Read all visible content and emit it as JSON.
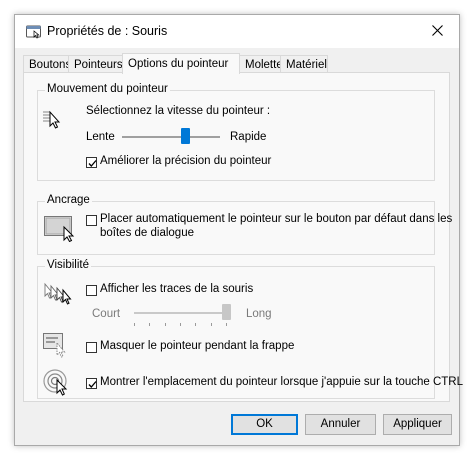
{
  "window": {
    "title": "Propriétés de : Souris"
  },
  "tabs": [
    {
      "label": "Boutons"
    },
    {
      "label": "Pointeurs"
    },
    {
      "label": "Options du pointeur"
    },
    {
      "label": "Molette"
    },
    {
      "label": "Matériel"
    }
  ],
  "motion": {
    "group_title": "Mouvement du pointeur",
    "speed_label": "Sélectionnez la vitesse du pointeur :",
    "slow_label": "Lente",
    "fast_label": "Rapide",
    "speed_value_fraction": 0.65,
    "precision_label": "Améliorer la précision du pointeur",
    "precision_checked": true
  },
  "snap": {
    "group_title": "Ancrage",
    "snap_label_line1": "Placer automatiquement le pointeur sur le bouton par défaut dans les",
    "snap_label_line2": "boîtes de dialogue",
    "snap_checked": false
  },
  "visibility": {
    "group_title": "Visibilité",
    "trails_label": "Afficher les traces de la souris",
    "trails_checked": false,
    "short_label": "Court",
    "long_label": "Long",
    "trails_value_fraction": 1.0,
    "hide_label": "Masquer le pointeur pendant la frappe",
    "hide_checked": false,
    "ctrl_label": "Montrer l'emplacement du pointeur lorsque j'appuie sur la touche CTRL",
    "ctrl_checked": true
  },
  "buttons": {
    "ok": "OK",
    "cancel": "Annuler",
    "apply": "Appliquer"
  },
  "colors": {
    "accent": "#0078d7"
  }
}
